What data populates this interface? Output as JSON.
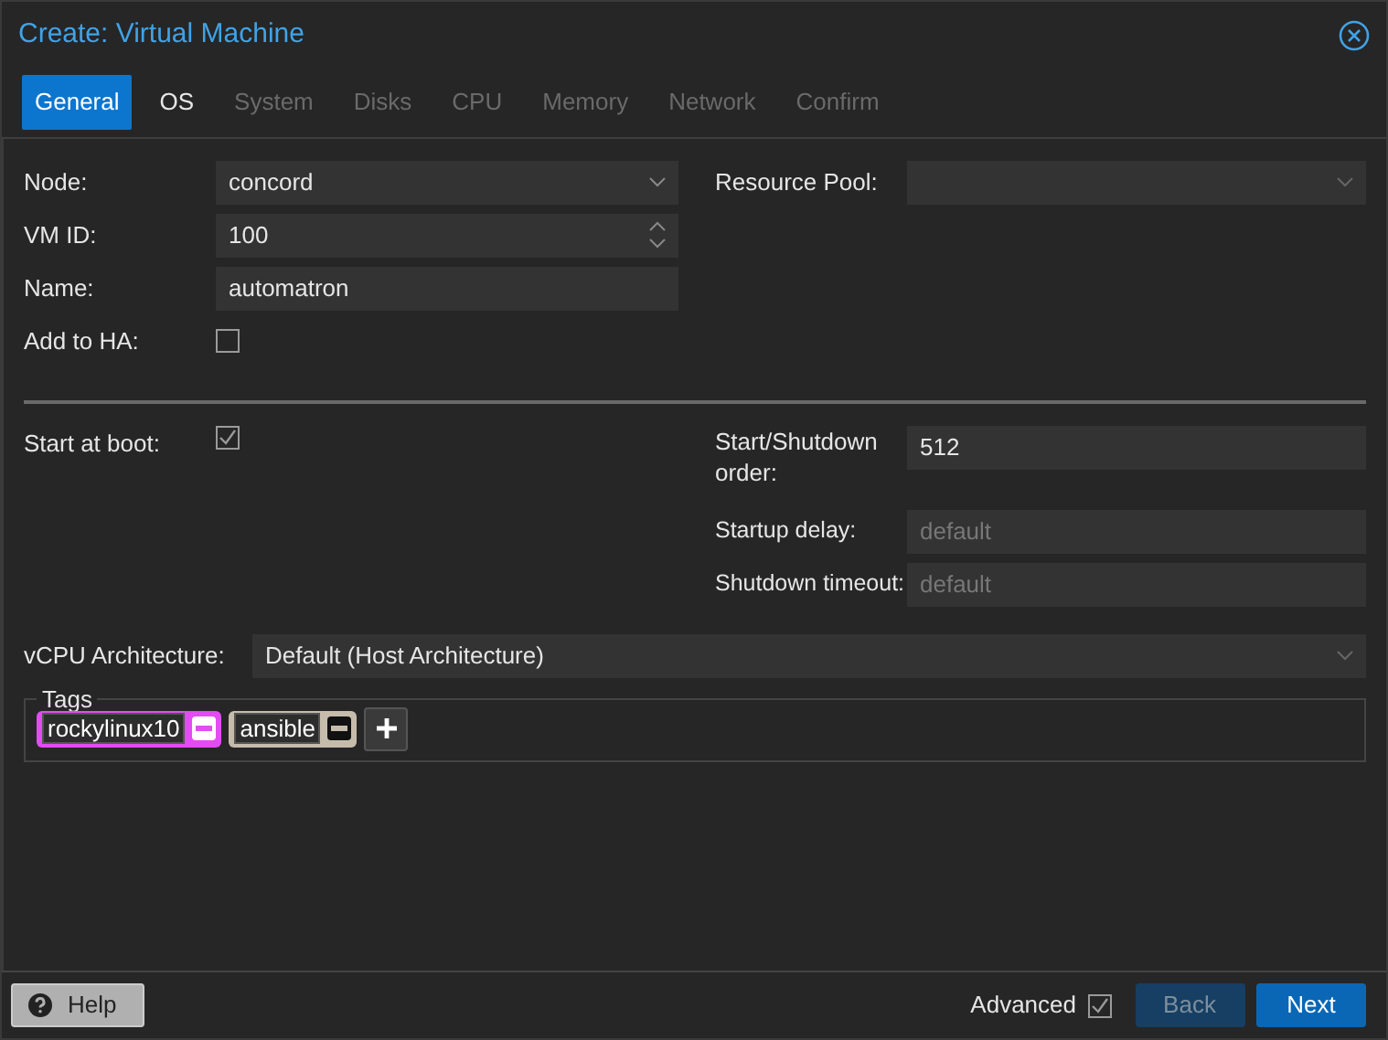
{
  "window": {
    "title": "Create: Virtual Machine"
  },
  "tabs": [
    {
      "label": "General",
      "selected": true,
      "disabled": false
    },
    {
      "label": "OS",
      "selected": false,
      "disabled": false
    },
    {
      "label": "System",
      "selected": false,
      "disabled": true
    },
    {
      "label": "Disks",
      "selected": false,
      "disabled": true
    },
    {
      "label": "CPU",
      "selected": false,
      "disabled": true
    },
    {
      "label": "Memory",
      "selected": false,
      "disabled": true
    },
    {
      "label": "Network",
      "selected": false,
      "disabled": true
    },
    {
      "label": "Confirm",
      "selected": false,
      "disabled": true
    }
  ],
  "left_fields": [
    {
      "kind": "combo",
      "label": "Node:",
      "value": "concord"
    },
    {
      "kind": "spinner",
      "label": "VM ID:",
      "value": "100"
    },
    {
      "kind": "text",
      "label": "Name:",
      "value": "automatron"
    },
    {
      "kind": "checkbox",
      "label": "Add to HA:",
      "checked": false
    }
  ],
  "resource_pool": {
    "label": "Resource Pool:"
  },
  "start_at_boot": {
    "label": "Start at boot:",
    "checked": true
  },
  "right_fields": [
    {
      "label": "Start/Shutdown order:",
      "value": "512"
    },
    {
      "label": "Startup delay:",
      "placeholder": "default"
    },
    {
      "label": "Shutdown timeout:",
      "placeholder": "default"
    }
  ],
  "vcpu": {
    "label": "vCPU Architecture:",
    "value": "Default (Host Architecture)"
  },
  "tags": {
    "legend": "Tags",
    "items": [
      {
        "label": "rockylinux10",
        "color": "#e14df0"
      },
      {
        "label": "ansible",
        "color": "#c6bcab"
      }
    ]
  },
  "footer": {
    "help": "Help",
    "advanced": {
      "label": "Advanced",
      "checked": true
    },
    "back": {
      "label": "Back",
      "disabled": true
    },
    "next": {
      "label": "Next"
    }
  }
}
